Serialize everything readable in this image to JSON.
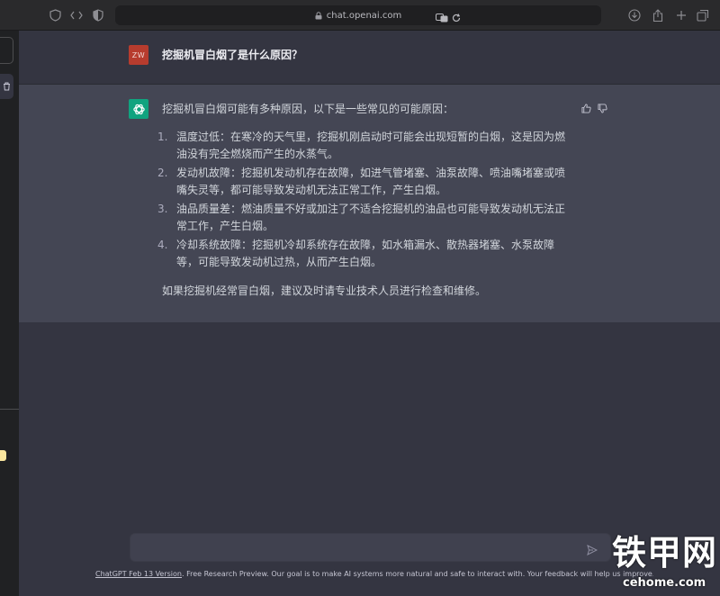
{
  "browser": {
    "url": "chat.openai.com"
  },
  "conversation": {
    "user": {
      "initials": "ZW",
      "message": "挖掘机冒白烟了是什么原因？"
    },
    "assistant": {
      "intro": "挖掘机冒白烟可能有多种原因，以下是一些常见的可能原因：",
      "items": [
        {
          "num": "1.",
          "text": "温度过低：在寒冷的天气里，挖掘机刚启动时可能会出现短暂的白烟，这是因为燃油没有完全燃烧而产生的水蒸气。"
        },
        {
          "num": "2.",
          "text": "发动机故障：挖掘机发动机存在故障，如进气管堵塞、油泵故障、喷油嘴堵塞或喷嘴失灵等，都可能导致发动机无法正常工作，产生白烟。"
        },
        {
          "num": "3.",
          "text": "油品质量差：燃油质量不好或加注了不适合挖掘机的油品也可能导致发动机无法正常工作，产生白烟。"
        },
        {
          "num": "4.",
          "text": "冷却系统故障：挖掘机冷却系统存在故障，如水箱漏水、散热器堵塞、水泵故障等，可能导致发动机过热，从而产生白烟。"
        }
      ],
      "outro": "如果挖掘机经常冒白烟，建议及时请专业技术人员进行检查和维修。"
    }
  },
  "composer": {
    "placeholder": ""
  },
  "footer": {
    "version_link": "ChatGPT Feb 13 Version",
    "text": ". Free Research Preview. Our goal is to make AI systems more natural and safe to interact with. Your feedback will help us improve."
  },
  "watermark": {
    "cn": "铁甲网",
    "url": "cehome.com"
  },
  "colors": {
    "bg": "#343541",
    "assistant_bg": "#444654",
    "sidebar_bg": "#202123",
    "user_avatar": "#b73c2e",
    "gpt_avatar": "#10a37f"
  }
}
